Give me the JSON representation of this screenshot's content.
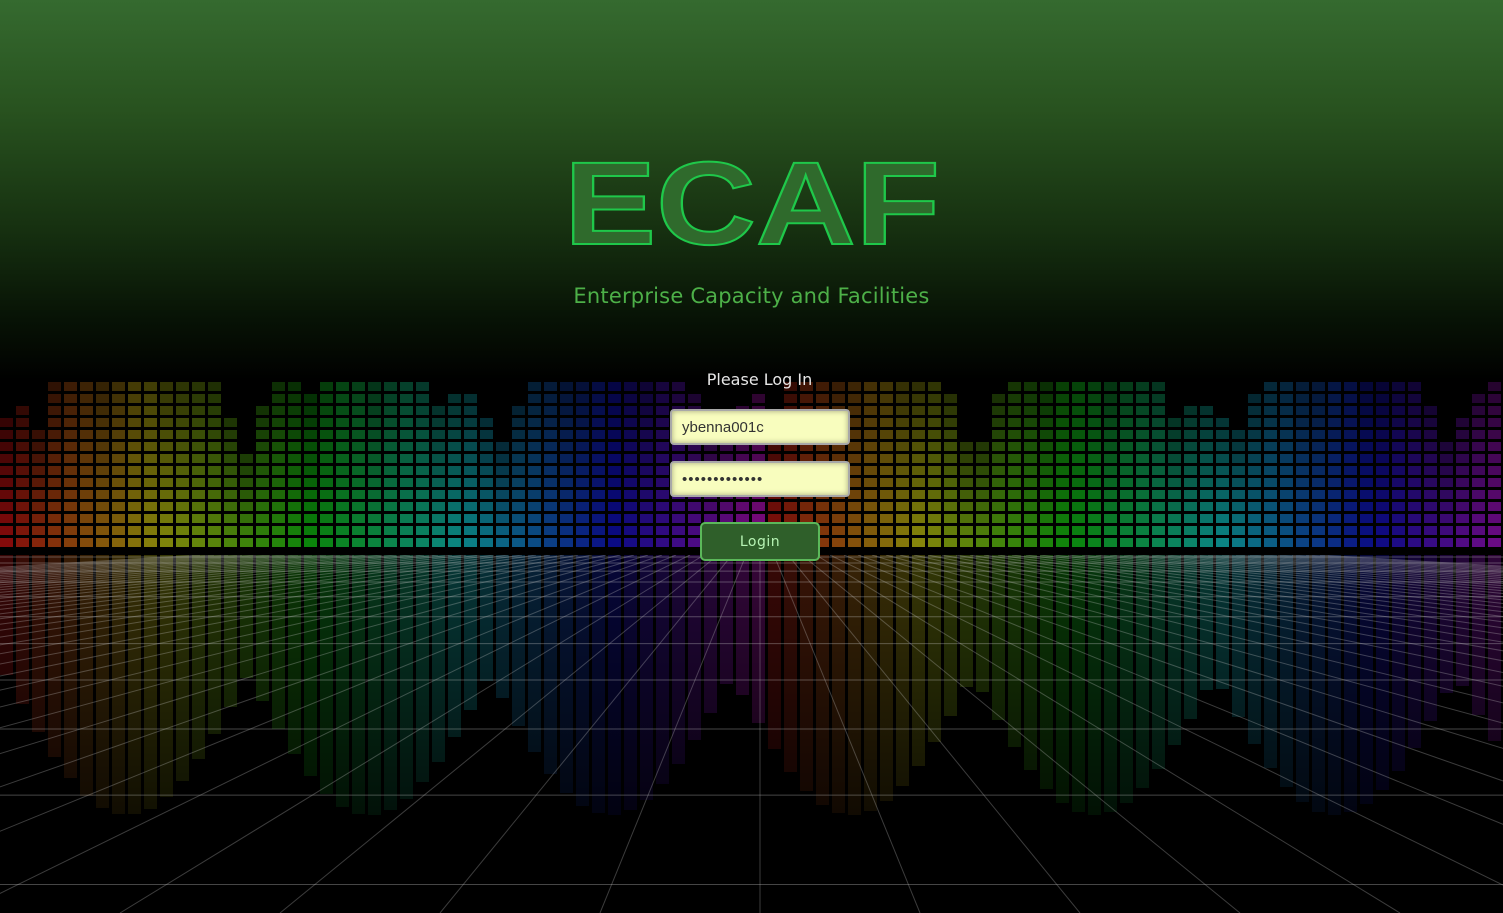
{
  "app": {
    "logo_text": "ECAF",
    "subtitle": "Enterprise Capacity and Facilities"
  },
  "login": {
    "prompt": "Please Log In",
    "username_value": "ybenna001c",
    "password_value": "•••••••••••••",
    "login_label": "Login"
  },
  "colors": {
    "brand_green": "#4db048",
    "button_bg": "#2f5f2a",
    "input_bg": "#f8fdbe"
  }
}
